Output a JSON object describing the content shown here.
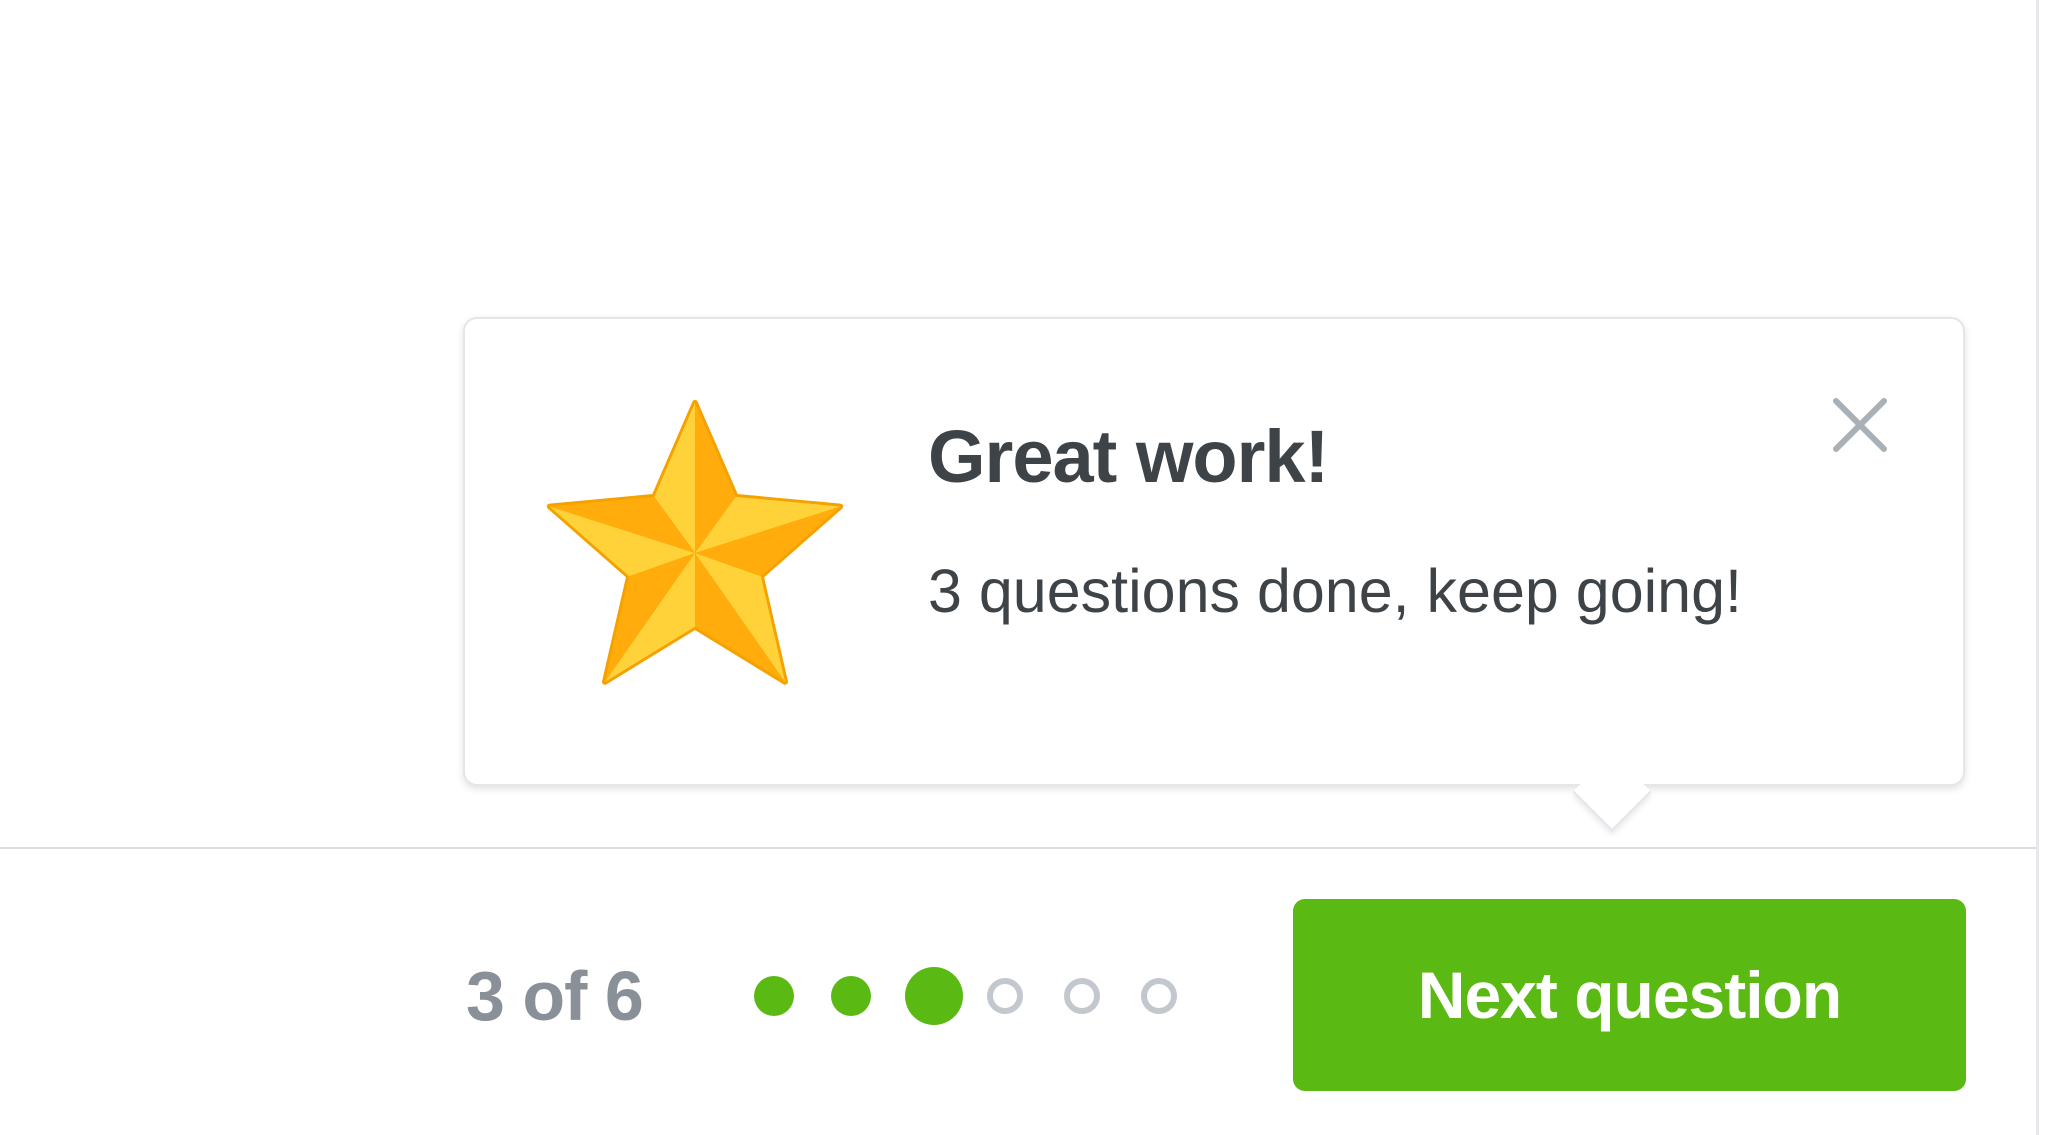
{
  "toast": {
    "icon": "star-icon",
    "title": "Great work!",
    "message": "3 questions done, keep going!",
    "close_icon": "close-icon"
  },
  "footer": {
    "progress_text": "3 of 6",
    "current": 3,
    "total": 6,
    "next_label": "Next question"
  },
  "colors": {
    "accent_green": "#5bb913",
    "title_text": "#3e4347",
    "muted_text": "#8a9097",
    "inactive_dot": "#c3c8ce",
    "close_icon": "#a9b0b6",
    "star_light": "#ffd23a",
    "star_dark": "#ffac0c"
  }
}
